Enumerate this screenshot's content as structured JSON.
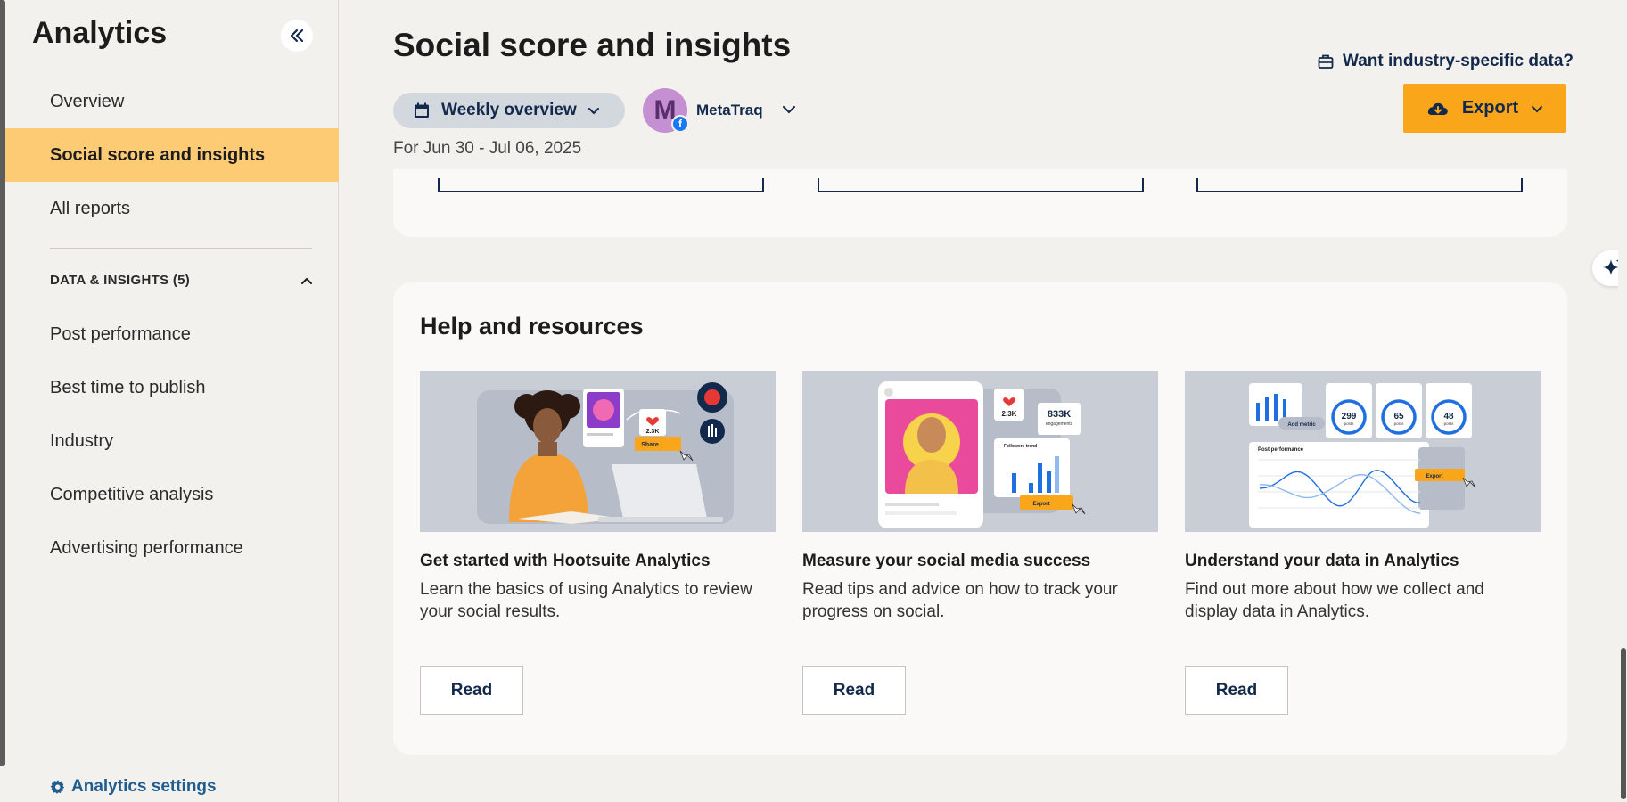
{
  "sidebar": {
    "title": "Analytics",
    "collapse_icon": "double-chevron-left-icon",
    "items": [
      {
        "label": "Overview"
      },
      {
        "label": "Social score and insights",
        "active": true
      },
      {
        "label": "All reports"
      }
    ],
    "section": {
      "label": "DATA & INSIGHTS (5)",
      "icon": "chevron-up-icon"
    },
    "section_items": [
      {
        "label": "Post performance"
      },
      {
        "label": "Best time to publish"
      },
      {
        "label": "Industry"
      },
      {
        "label": "Competitive analysis"
      },
      {
        "label": "Advertising performance"
      }
    ],
    "settings_label": "Analytics settings"
  },
  "header": {
    "title": "Social score and insights",
    "industry_link": "Want industry-specific data?",
    "period_label": "Weekly overview",
    "account_initial": "M",
    "account_name": "MetaTraq",
    "date_range": "For Jun 30 - Jul 06, 2025",
    "export_label": "Export"
  },
  "help": {
    "title": "Help and resources",
    "resources": [
      {
        "title": "Get started with Hootsuite Analytics",
        "description": "Learn the basics of using Analytics to review your social results.",
        "button": "Read",
        "img_texts": {
          "likes": "2.3K",
          "share": "Share"
        }
      },
      {
        "title": "Measure your social media success",
        "description": "Read tips and advice on how to track your progress on social.",
        "button": "Read",
        "img_texts": {
          "likes": "2.3K",
          "engagements": "833K",
          "engagements_label": "engagements",
          "trend": "Followers trend",
          "export": "Export"
        }
      },
      {
        "title": "Understand your data in Analytics",
        "description": "Find out more about how we collect and display data in Analytics.",
        "button": "Read",
        "img_texts": {
          "add_metric": "Add metric",
          "post_perf": "Post performance",
          "export": "Export",
          "gauges": [
            "299",
            "65",
            "48"
          ],
          "gauge_unit": "posts"
        }
      }
    ]
  },
  "colors": {
    "accent": "#fdcb74",
    "export": "#f9a61a",
    "navy": "#13294b",
    "link": "#1f5d8f"
  }
}
